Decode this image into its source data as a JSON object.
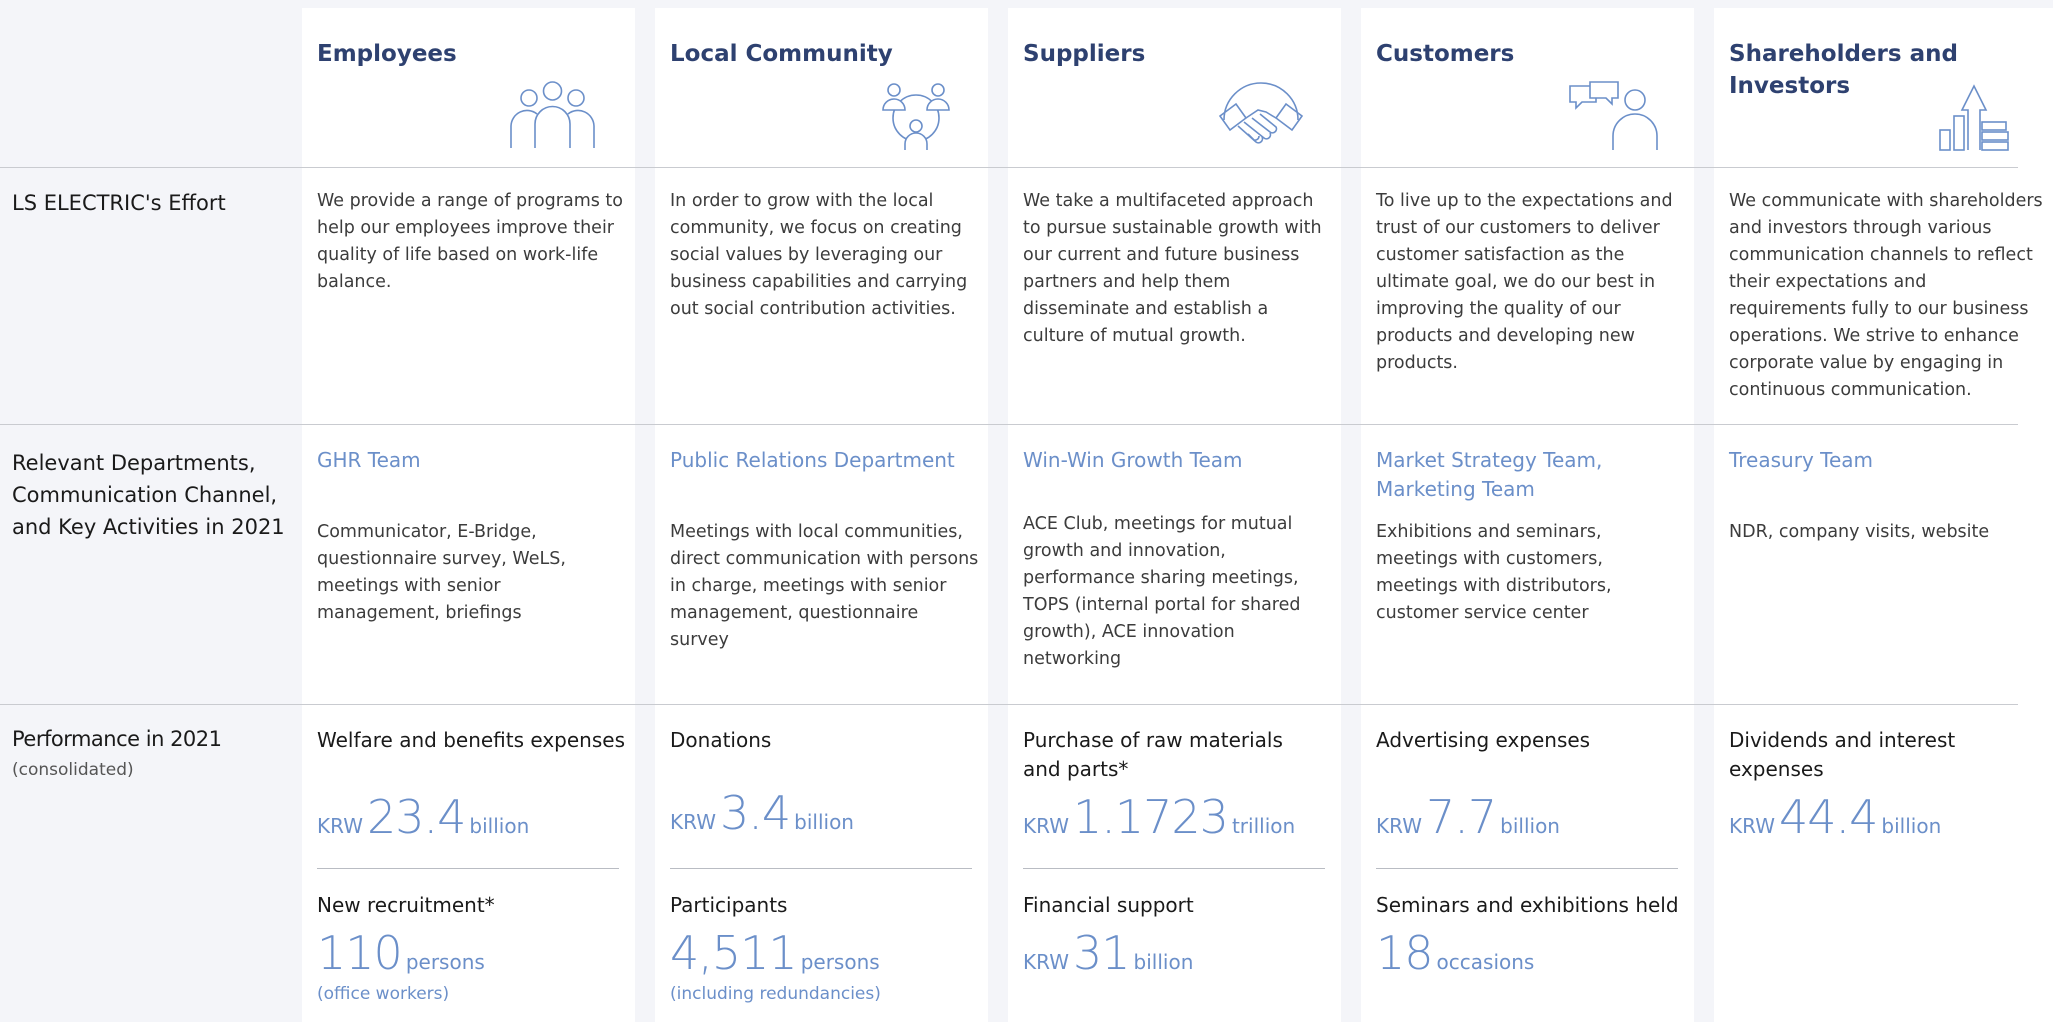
{
  "row_labels": {
    "effort": "LS ELECTRIC's Effort",
    "departments": "Relevant Departments, Communication Channel, and Key Activities in 2021",
    "performance": "Performance in 2021",
    "performance_sub": "(consolidated)"
  },
  "columns": [
    {
      "title": "Employees",
      "icon": "people-group-icon",
      "effort": "We provide a range of programs to help our employees improve their quality of life based on work-life balance.",
      "department": "GHR Team",
      "channels": "Communicator, E-Bridge, questionnaire survey, WeLS, meetings with senior management, briefings",
      "metric1": {
        "label": "Welfare and benefits expenses",
        "prefix": "KRW",
        "value": "23.4",
        "suffix": "billion"
      },
      "metric2": {
        "label": "New recruitment*",
        "prefix": "",
        "value": "110",
        "suffix": "persons",
        "note": "(office workers)"
      }
    },
    {
      "title": "Local Community",
      "icon": "community-circle-icon",
      "effort": "In order to grow with the local community, we focus on creating social values by leveraging our business capabilities and carrying out social contribution activities.",
      "department": "Public Relations Department",
      "channels": "Meetings with local communities, direct communication with persons in charge, meetings with senior management, questionnaire survey",
      "metric1": {
        "label": "Donations",
        "prefix": "KRW",
        "value": "3.4",
        "suffix": "billion"
      },
      "metric2": {
        "label": "Participants",
        "prefix": "",
        "value": "4,511",
        "suffix": "persons",
        "note": "(including redundancies)"
      }
    },
    {
      "title": "Suppliers",
      "icon": "handshake-icon",
      "effort": "We take a multifaceted approach to pursue sustainable growth with our current and future business partners and help them disseminate and establish a culture of mutual growth.",
      "department": "Win-Win Growth Team",
      "channels": "ACE Club, meetings for mutual growth and innovation, performance sharing meetings, TOPS (internal portal for shared growth), ACE innovation networking",
      "metric1": {
        "label": "Purchase of raw materials and parts*",
        "prefix": "KRW",
        "value": "1.1723",
        "suffix": "trillion"
      },
      "metric2": {
        "label": "Financial support",
        "prefix": "KRW",
        "value": "31",
        "suffix": "billion",
        "note": ""
      }
    },
    {
      "title": "Customers",
      "icon": "customer-chat-icon",
      "effort": "To live up to the expectations and trust of our customers to deliver customer satisfaction as the ultimate goal, we do our best in improving the quality of our products and developing new products.",
      "department": "Market Strategy Team, Marketing Team",
      "channels": "Exhibitions and seminars, meetings with customers, meetings with distributors, customer service center",
      "metric1": {
        "label": "Advertising expenses",
        "prefix": "KRW",
        "value": "7.7",
        "suffix": "billion"
      },
      "metric2": {
        "label": "Seminars and exhibitions held",
        "prefix": "",
        "value": "18",
        "suffix": "occasions",
        "note": ""
      }
    },
    {
      "title": "Shareholders and Investors",
      "icon": "growth-chart-icon",
      "effort": "We communicate with shareholders and investors through various communication channels to reflect their expectations and requirements fully to our business operations. We strive to enhance corporate value by engaging in continuous communication.",
      "department": "Treasury Team",
      "channels": "NDR, company visits, website",
      "metric1": {
        "label": "Dividends and interest expenses",
        "prefix": "KRW",
        "value": "44.4",
        "suffix": "billion"
      }
    }
  ]
}
